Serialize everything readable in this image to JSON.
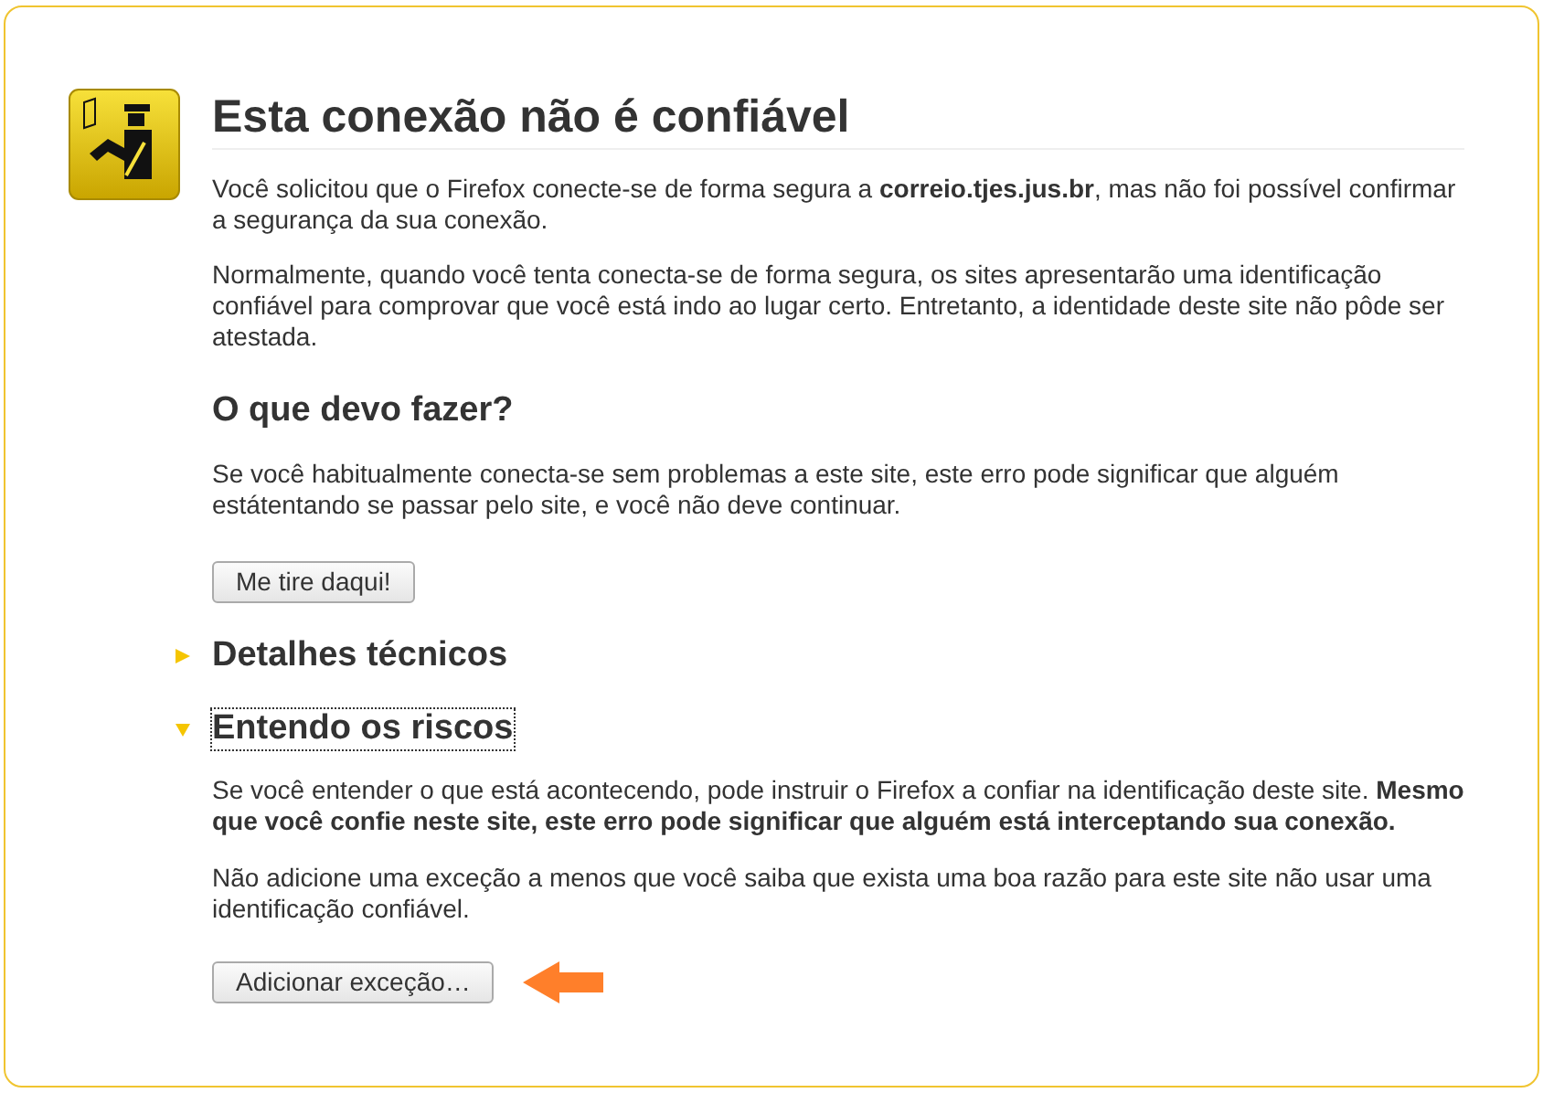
{
  "title": "Esta conexão não é confiável",
  "intro": [
    "Você solicitou que o Firefox conecte-se de forma segura a **correio.tjes.jus.br**, mas não foi possível confirmar a segurança da sua conexão.",
    "Normalmente, quando você tenta conecta-se de forma segura, os sites apresentarão uma identificação confiável para comprovar que você está indo ao lugar certo. Entretanto, a identidade deste site não pôde ser atestada."
  ],
  "what_to_do": {
    "heading": "O que devo fazer?",
    "paragraph": "Se você habitualmente conecta-se sem problemas a este site, este erro pode significar que alguém estátentando se passar pelo site, e você não deve continuar.",
    "button": "Me tire daqui!"
  },
  "sections": [
    {
      "title": "Detalhes técnicos",
      "expanded": false,
      "focused": false
    },
    {
      "title": "Entendo os riscos",
      "expanded": true,
      "focused": true,
      "paragraphs": [
        "Se você entender o que está acontecendo, pode instruir o Firefox a confiar na identificação deste site. **Mesmo que você confie neste site, este erro pode significar que alguém está interceptando sua conexão.**",
        "Não adicione uma exceção a menos que você saiba que exista uma boa razão para este site não usar uma identificação confiável."
      ],
      "button": "Adicionar exceção…"
    }
  ]
}
